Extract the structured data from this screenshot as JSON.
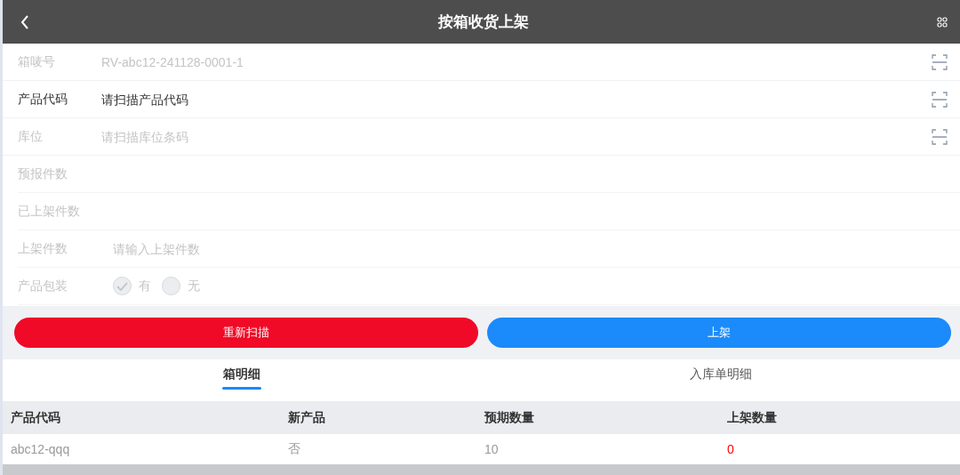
{
  "header": {
    "title": "按箱收货上架"
  },
  "scan_fields": [
    {
      "label": "箱唛号",
      "value": "RV-abc12-241128-0001-1",
      "disabled": true
    },
    {
      "label": "产品代码",
      "placeholder": "请扫描产品代码",
      "disabled": false
    },
    {
      "label": "库位",
      "placeholder": "请扫描库位条码",
      "disabled": true
    }
  ],
  "fields": [
    {
      "kind": "text",
      "label": "预报件数",
      "disabled": true
    },
    {
      "kind": "text",
      "label": "已上架件数",
      "disabled": true
    },
    {
      "kind": "input",
      "label": "上架件数",
      "placeholder": "请输入上架件数",
      "disabled": true
    },
    {
      "kind": "radio",
      "label": "产品包装",
      "disabled": true,
      "options": [
        {
          "label": "有",
          "selected": true
        },
        {
          "label": "无",
          "selected": false
        }
      ]
    }
  ],
  "buttons": [
    {
      "kind": "danger",
      "label": "重新扫描"
    },
    {
      "kind": "primary",
      "label": "上架"
    }
  ],
  "tabs": [
    {
      "label": "箱明细",
      "selected": true
    },
    {
      "label": "入库单明细",
      "selected": false
    }
  ],
  "table": {
    "columns": [
      "产品代码",
      "新产品",
      "预期数量",
      "上架数量"
    ],
    "rows": [
      [
        {
          "text": "abc12-qqq",
          "alert": false
        },
        {
          "text": "否",
          "alert": false
        },
        {
          "text": "10",
          "alert": false
        },
        {
          "text": "0",
          "alert": true
        }
      ]
    ]
  }
}
